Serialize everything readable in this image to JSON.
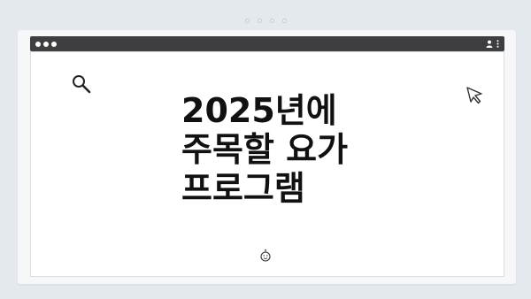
{
  "window": {
    "outer_dot_count": 4,
    "titlebar_color": "#3e3e40"
  },
  "title": {
    "lines": [
      "2025년에",
      "주목할 요가",
      "프로그램"
    ]
  },
  "icons": {
    "top_left": "search-icon",
    "top_right": "cursor-icon",
    "bottom": "smile-icon",
    "titlebar_right": [
      "user-icon",
      "kebab-menu-icon"
    ]
  }
}
